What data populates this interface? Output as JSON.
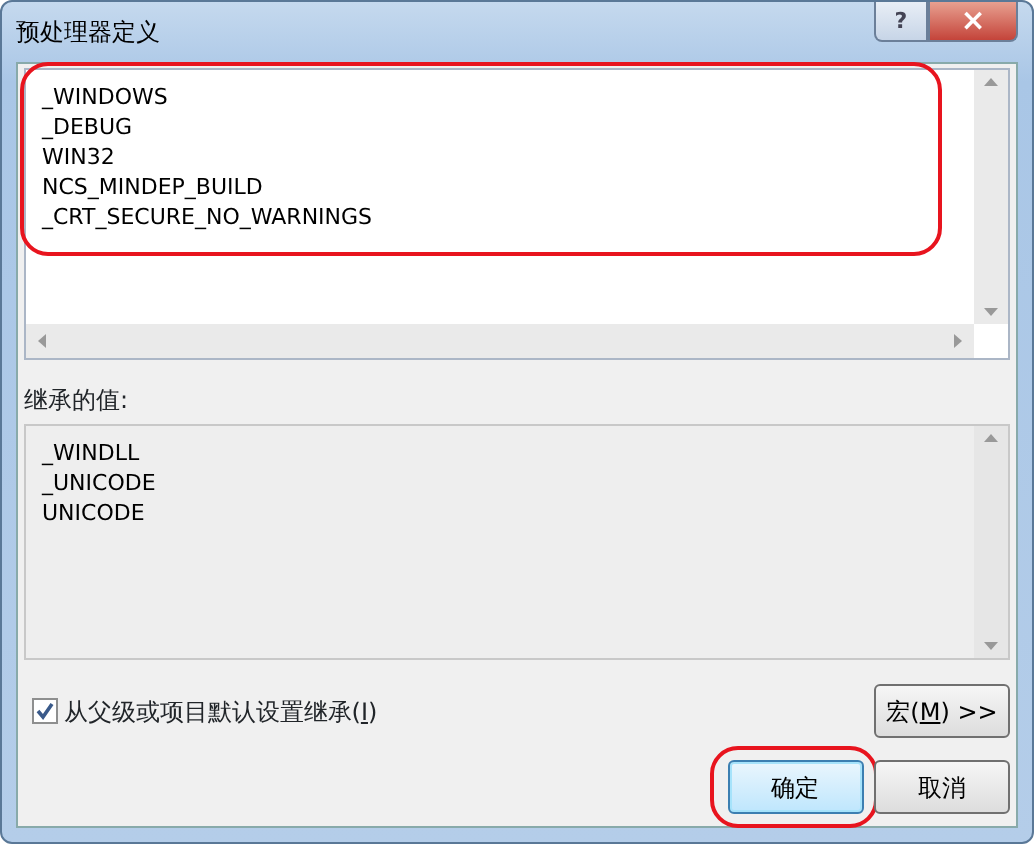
{
  "window": {
    "title": "预处理器定义",
    "help_button": "?",
    "close_button": "×"
  },
  "definitions": {
    "lines": [
      "_WINDOWS",
      "_DEBUG",
      "WIN32",
      "NCS_MINDEP_BUILD",
      "_CRT_SECURE_NO_WARNINGS"
    ],
    "highlighted": true
  },
  "inherited": {
    "label": "继承的值:",
    "lines": [
      "_WINDLL",
      "_UNICODE",
      "UNICODE"
    ]
  },
  "inherit_checkbox": {
    "before": "从父级或项目默认设置继承(",
    "mnemonic": "I",
    "after": ")",
    "checked": true
  },
  "macro_button": {
    "before": "宏(",
    "mnemonic": "M",
    "after": ") >>"
  },
  "buttons": [
    {
      "label": "确定",
      "default": true,
      "highlighted": true
    },
    {
      "label": "取消",
      "default": false,
      "highlighted": false
    }
  ]
}
